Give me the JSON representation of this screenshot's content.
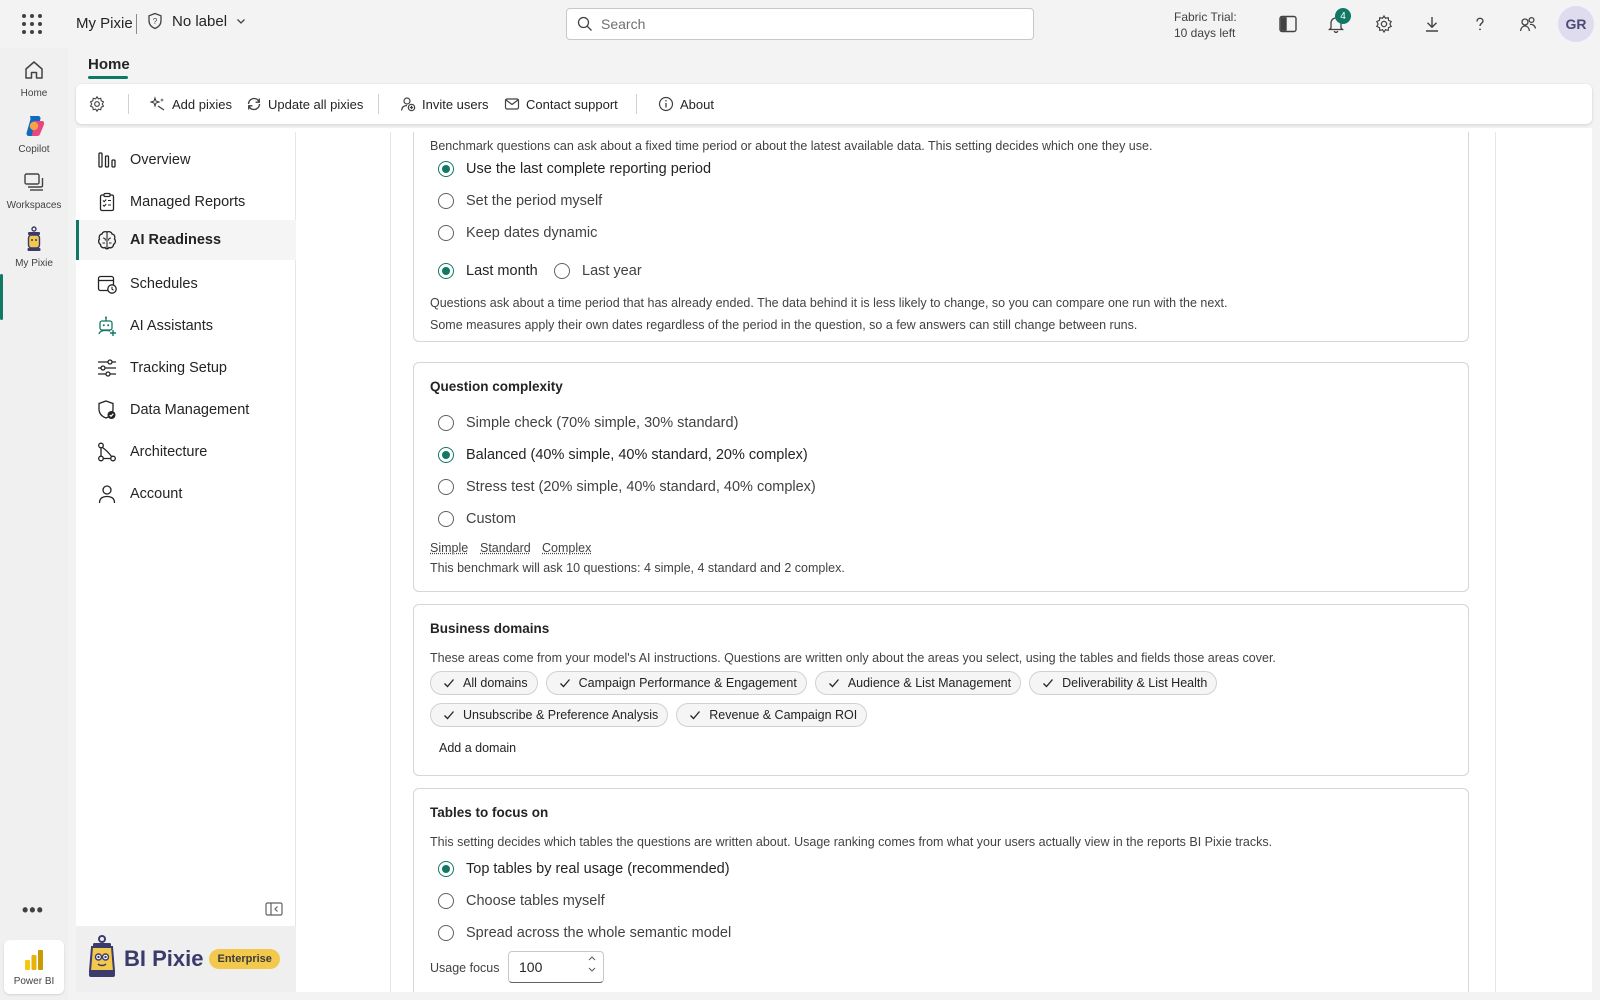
{
  "topbar": {
    "app_name": "My Pixie",
    "label_text": "No label",
    "search_placeholder": "Search",
    "trial_line1": "Fabric Trial:",
    "trial_line2": "10 days left",
    "notification_count": "4",
    "avatar_initials": "GR"
  },
  "rail": {
    "items": [
      {
        "label": "Home",
        "icon": "home-icon"
      },
      {
        "label": "Copilot",
        "icon": "copilot-icon"
      },
      {
        "label": "Workspaces",
        "icon": "workspaces-icon"
      },
      {
        "label": "My Pixie",
        "icon": "pixie-lantern-icon"
      }
    ],
    "more": "•••",
    "footer_label": "Power BI"
  },
  "home_tab": "Home",
  "toolbar": {
    "add_pixies": "Add pixies",
    "update_all": "Update all pixies",
    "invite_users": "Invite users",
    "contact_support": "Contact support",
    "about": "About"
  },
  "sidenav": {
    "items": [
      {
        "label": "Overview",
        "icon": "bar-chart-icon"
      },
      {
        "label": "Managed Reports",
        "icon": "clipboard-checklist-icon"
      },
      {
        "label": "AI Readiness",
        "icon": "brain-icon",
        "active": true
      },
      {
        "label": "Schedules",
        "icon": "calendar-clock-icon"
      },
      {
        "label": "AI Assistants",
        "icon": "bot-icon"
      },
      {
        "label": "Tracking Setup",
        "icon": "sliders-icon"
      },
      {
        "label": "Data Management",
        "icon": "shield-check-icon"
      },
      {
        "label": "Architecture",
        "icon": "flow-icon"
      },
      {
        "label": "Account",
        "icon": "person-icon"
      }
    ],
    "brand_name": "BI Pixie",
    "brand_badge": "Enterprise"
  },
  "period_card": {
    "description": "Benchmark questions can ask about a fixed time period or about the latest available data. This setting decides which one they use.",
    "options": [
      {
        "label": "Use the last complete reporting period",
        "selected": true
      },
      {
        "label": "Set the period myself",
        "selected": false
      },
      {
        "label": "Keep dates dynamic",
        "selected": false
      }
    ],
    "sub_options": [
      {
        "label": "Last month",
        "selected": true
      },
      {
        "label": "Last year",
        "selected": false
      }
    ],
    "note1": "Questions ask about a time period that has already ended. The data behind it is less likely to change, so you can compare one run with the next.",
    "note2": "Some measures apply their own dates regardless of the period in the question, so a few answers can still change between runs."
  },
  "complexity_card": {
    "title": "Question complexity",
    "options": [
      {
        "label": "Simple check (70% simple, 30% standard)",
        "selected": false
      },
      {
        "label": "Balanced (40% simple, 40% standard, 20% complex)",
        "selected": true
      },
      {
        "label": "Stress test (20% simple, 40% standard, 40% complex)",
        "selected": false
      },
      {
        "label": "Custom",
        "selected": false
      }
    ],
    "levels": [
      "Simple",
      "Standard",
      "Complex"
    ],
    "summary": "This benchmark will ask 10 questions: 4 simple, 4 standard and 2 complex."
  },
  "domains_card": {
    "title": "Business domains",
    "description": "These areas come from your model's AI instructions. Questions are written only about the areas you select, using the tables and fields those areas cover.",
    "chips_row1": [
      "All domains",
      "Campaign Performance & Engagement",
      "Audience & List Management",
      "Deliverability & List Health"
    ],
    "chips_row2": [
      "Unsubscribe & Preference Analysis",
      "Revenue & Campaign ROI"
    ],
    "add_domain": "Add a domain"
  },
  "tables_card": {
    "title": "Tables to focus on",
    "description": "This setting decides which tables the questions are written about. Usage ranking comes from what your users actually view in the reports BI Pixie tracks.",
    "options": [
      {
        "label": "Top tables by real usage (recommended)",
        "selected": true
      },
      {
        "label": "Choose tables myself",
        "selected": false
      },
      {
        "label": "Spread across the whole semantic model",
        "selected": false
      }
    ],
    "usage_label": "Usage focus",
    "usage_value": "100"
  },
  "colors": {
    "accent": "#117865",
    "brand": "#3b3b6b",
    "badge": "#f2c94c"
  }
}
